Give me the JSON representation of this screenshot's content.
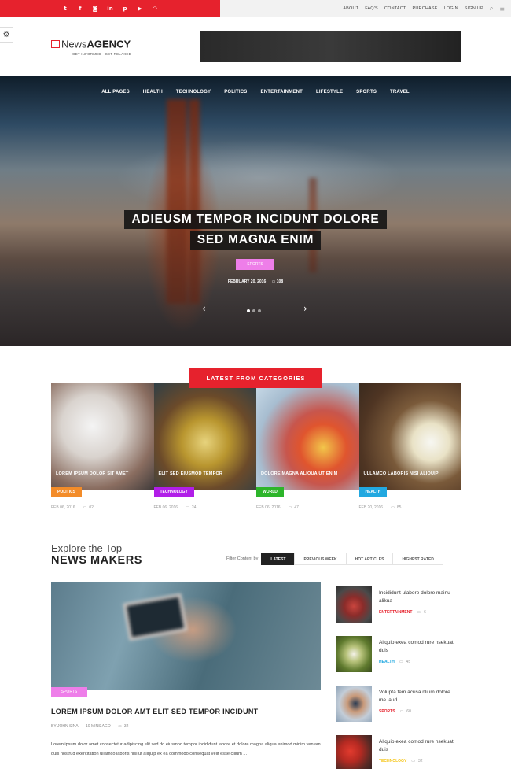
{
  "topbar": {
    "social_icons": [
      {
        "name": "twitter-icon",
        "glyph": "t"
      },
      {
        "name": "facebook-icon",
        "glyph": "f"
      },
      {
        "name": "instagram-icon",
        "glyph": "◙"
      },
      {
        "name": "linkedin-icon",
        "glyph": "in"
      },
      {
        "name": "pinterest-icon",
        "glyph": "p"
      },
      {
        "name": "youtube-icon",
        "glyph": "▶"
      },
      {
        "name": "rss-icon",
        "glyph": "◠"
      }
    ],
    "links": [
      "ABOUT",
      "FAQ'S",
      "CONTACT",
      "PURCHASE",
      "LOGIN",
      "SIGN UP"
    ],
    "accent": "#e6222d"
  },
  "logo": {
    "name_light": "News",
    "name_bold": "AGENCY",
    "tagline": "GET INFORMED - GET RELAXED"
  },
  "nav": [
    "ALL PAGES",
    "HEALTH",
    "TECHNOLOGY",
    "POLITICS",
    "ENTERTAINMENT",
    "LIFESTYLE",
    "SPORTS",
    "TRAVEL"
  ],
  "hero": {
    "title_line1": "ADIEUSM TEMPOR INCIDUNT DOLORE",
    "title_line2": "SED MAGNA ENIM",
    "category": "SPORTS",
    "date": "FEBRUARY 20, 2016",
    "comments": "108",
    "prev": "‹",
    "next": "›"
  },
  "latest": {
    "heading": "LATEST FROM CATEGORIES",
    "cards": [
      {
        "title": "LOREM IPSUM DOLOR SIT AMET",
        "category": "POLITICS",
        "cat_color": "#f38c29",
        "date": "FEB 06, 2016",
        "comments": "02"
      },
      {
        "title": "ELIT SED EIUSMOD TEMPOR",
        "category": "TECHNOLOGY",
        "cat_color": "#b11ee8",
        "date": "FEB 06, 2016",
        "comments": "24"
      },
      {
        "title": "DOLORE MAGNA ALIQUA UT ENIM",
        "category": "WORLD",
        "cat_color": "#2db52a",
        "date": "FEB 06, 2016",
        "comments": "47"
      },
      {
        "title": "ULLAMCO LABORIS NISI ALIQUIP",
        "category": "HEALTH",
        "cat_color": "#22a8e0",
        "date": "FEB 20, 2016",
        "comments": "85"
      }
    ]
  },
  "explore": {
    "line1": "Explore the Top",
    "line2": "NEWS MAKERS",
    "filter_label": "Filter Content by",
    "tabs": [
      "LATEST",
      "PREVIOUS WEEK",
      "HOT ARTICLES",
      "HIGHEST RATED"
    ]
  },
  "featured": {
    "category": "SPORTS",
    "title": "LOREM IPSUM DOLOR AMT ELIT SED TEMPOR INCIDUNT",
    "author": "BY JOHN SINA",
    "time": "10 MINS AGO",
    "comments": "32",
    "excerpt": "Lorem ipsum dolor amet consectetur adipiscing elit sed do eiusmod tempor incididunt labore et dolore magna aliqua enimod minim veniam quis nostrud exercitation ullamco laboris nisi ut aliquip ex ea commodo consequat velit esse cillum ..."
  },
  "sidebar": [
    {
      "title": "Incididunt ulabore dolore mainu alikua",
      "category": "ENTERTAINMENT",
      "cat_color": "#e6222d",
      "comments": "6"
    },
    {
      "title": "Aliquip exea comod rure nsekuat duis",
      "category": "HEALTH",
      "cat_color": "#22a8e0",
      "comments": "45"
    },
    {
      "title": "Volupta tem acusa nlium dolore me laud",
      "category": "SPORTS",
      "cat_color": "#e6222d",
      "comments": "60"
    },
    {
      "title": "Aliquip exea comod rure nsekuat duis",
      "category": "TECHNOLOGY",
      "cat_color": "#f5c518",
      "comments": "32"
    }
  ]
}
